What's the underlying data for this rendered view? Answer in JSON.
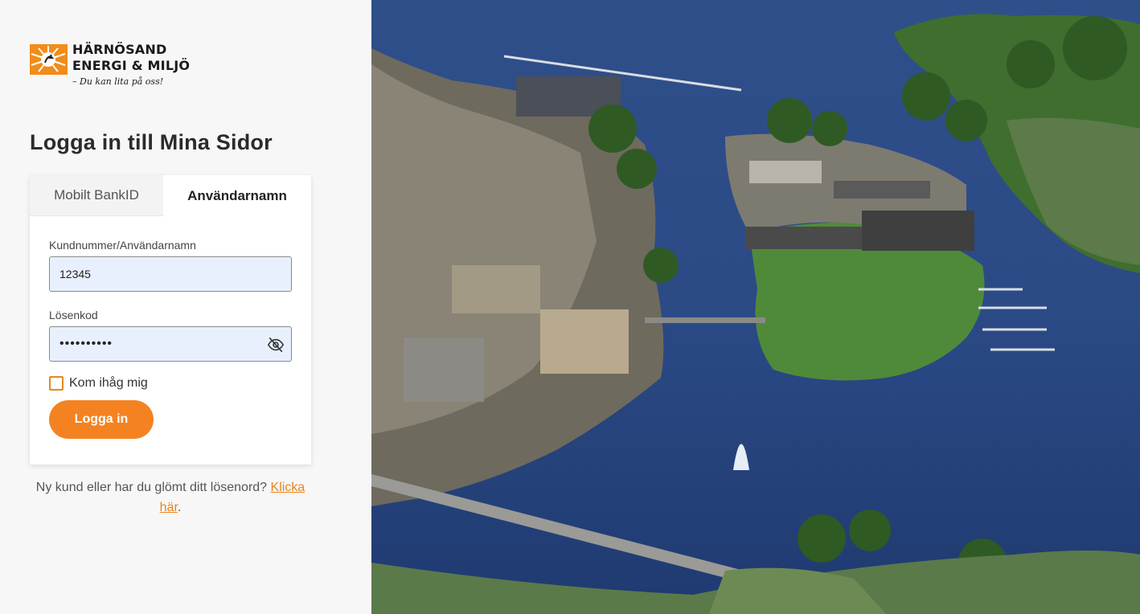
{
  "brand": {
    "line1": "HÄRNÖSAND",
    "line2": "ENERGI & MILJÖ",
    "tagline": "– Du kan lita på oss!",
    "accent_color": "#f58220"
  },
  "login": {
    "title": "Logga in till Mina Sidor",
    "tabs": [
      {
        "label": "Mobilt BankID",
        "active": false
      },
      {
        "label": "Användarnamn",
        "active": true
      }
    ],
    "username": {
      "label": "Kundnummer/Användarnamn",
      "value": "12345"
    },
    "password": {
      "label": "Lösenkod",
      "value": "••••••••••",
      "icon": "eye-slash-icon"
    },
    "remember_label": "Kom ihåg mig",
    "remember_checked": false,
    "submit_label": "Logga in"
  },
  "footer": {
    "text": "Ny kund eller har du glömt ditt lösenord? ",
    "link_text": "Klicka här",
    "suffix": "."
  },
  "hero": {
    "icon": "aerial-city-photo"
  }
}
